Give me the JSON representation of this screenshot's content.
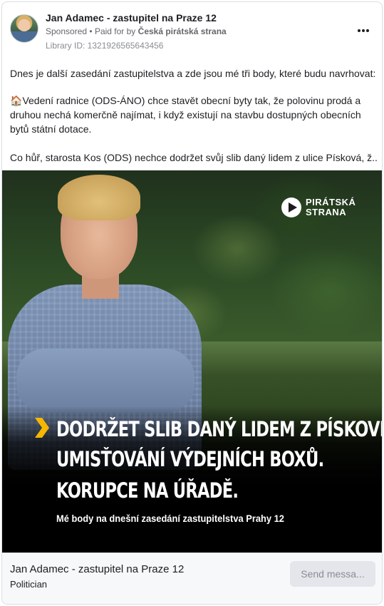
{
  "post": {
    "page_name": "Jan Adamec - zastupitel na Praze 12",
    "sponsored_label": "Sponsored",
    "separator": "•",
    "paid_for_prefix": "Paid for by",
    "payer": "Česká pirátská strana",
    "library_id": "Library ID: 1321926565643456",
    "more_icon": "more-horizontal-icon"
  },
  "body": {
    "paragraph1": "Dnes je další zasedání zastupitelstva a zde jsou mé tři body, které budu navrhovat:",
    "paragraph2_emoji": "🏠",
    "paragraph2": "Vedení radnice (ODS-ÁNO) chce stavět obecní byty tak, že polovinu prodá a druhou nechá komerčně najímat, i když existují na stavbu dostupných obecních bytů státní dotace.",
    "paragraph3": "Co hůř, starosta Kos (ODS) nechce dodržet svůj slib daný lidem z ulice Písková, ž..."
  },
  "image": {
    "logo_line1": "PIRÁTSKÁ",
    "logo_line2": "STRANA",
    "headline1": "DODRŽET SLIB DANÝ LIDEM Z PÍSKOVÉ.",
    "headline2": "UMISŤOVÁNÍ VÝDEJNÍCH BOXŮ.",
    "headline3": "KORUPCE NA ÚŘADĚ.",
    "subline": "Mé body na dnešní zasedání zastupitelstva Prahy 12",
    "accent_color": "#f6b700"
  },
  "footer": {
    "title": "Jan Adamec - zastupitel na Praze 12",
    "category": "Politician",
    "send_button": "Send messa..."
  }
}
